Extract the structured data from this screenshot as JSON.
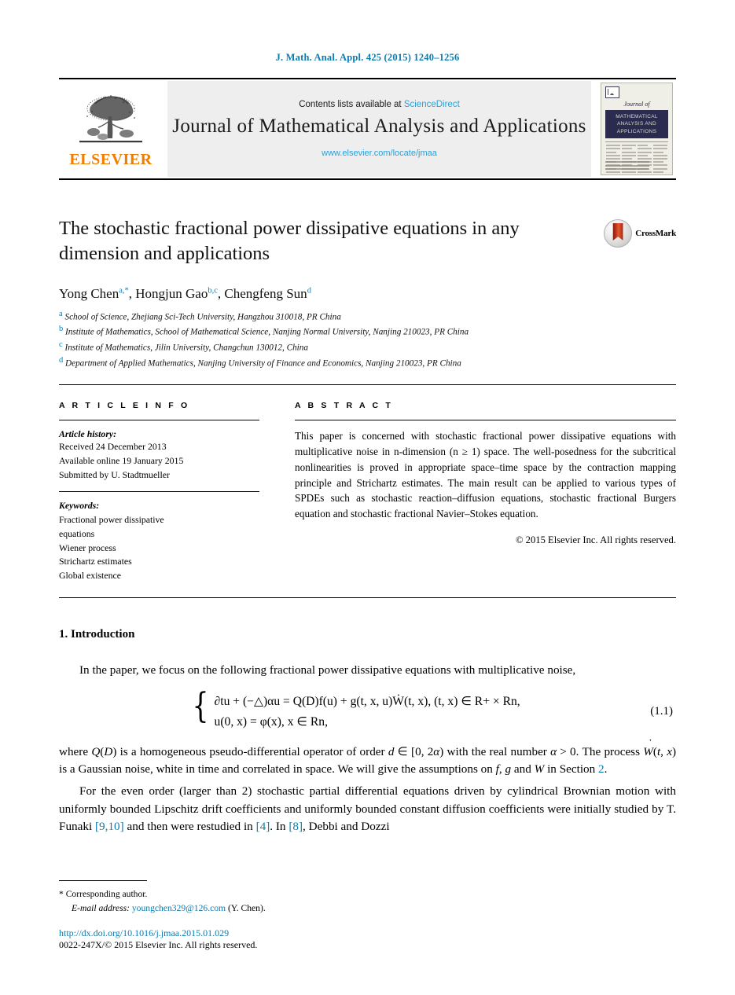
{
  "running_head": "J. Math. Anal. Appl. 425 (2015) 1240–1256",
  "masthead": {
    "publisher_name": "ELSEVIER",
    "contents_prefix": "Contents lists available at ",
    "contents_link": "ScienceDirect",
    "journal_title": "Journal of Mathematical Analysis and Applications",
    "journal_url": "www.elsevier.com/locate/jmaa",
    "cover": {
      "script_title": "Journal of",
      "band_title": "MATHEMATICAL ANALYSIS AND APPLICATIONS"
    }
  },
  "article": {
    "title": "The stochastic fractional power dissipative equations in any dimension and applications",
    "crossmark_label": "CrossMark",
    "authors_html": "Yong Chen <sup>a,*</sup>, Hongjun Gao <sup>b,c</sup>, Chengfeng Sun <sup>d</sup>",
    "affiliations": [
      {
        "marker": "a",
        "text": "School of Science, Zhejiang Sci-Tech University, Hangzhou 310018, PR China"
      },
      {
        "marker": "b",
        "text": "Institute of Mathematics, School of Mathematical Science, Nanjing Normal University, Nanjing 210023, PR China"
      },
      {
        "marker": "c",
        "text": "Institute of Mathematics, Jilin University, Changchun 130012, China"
      },
      {
        "marker": "d",
        "text": "Department of Applied Mathematics, Nanjing University of Finance and Economics, Nanjing 210023, PR China"
      }
    ]
  },
  "info": {
    "heading": "A R T I C L E   I N F O",
    "history_label": "Article history:",
    "history": [
      "Received 24 December 2013",
      "Available online 19 January 2015",
      "Submitted by U. Stadtmueller"
    ],
    "keywords_label": "Keywords:",
    "keywords": [
      "Fractional power dissipative",
      "equations",
      "Wiener process",
      "Strichartz estimates",
      "Global existence"
    ]
  },
  "abstract": {
    "heading": "A B S T R A C T",
    "text": "This paper is concerned with stochastic fractional power dissipative equations with multiplicative noise in n-dimension (n ≥ 1) space. The well-posedness for the subcritical nonlinearities is proved in appropriate space–time space by the contraction mapping principle and Strichartz estimates. The main result can be applied to various types of SPDEs such as stochastic reaction–diffusion equations, stochastic fractional Burgers equation and stochastic fractional Navier–Stokes equation.",
    "copyright": "© 2015 Elsevier Inc. All rights reserved."
  },
  "body": {
    "section_title": "1. Introduction",
    "para1": "In the paper, we focus on the following fractional power dissipative equations with multiplicative noise,",
    "equation": {
      "line1": "∂tu + (−△)αu = Q(D)f(u) + g(t, x, u)Ẇ(t, x),   (t, x) ∈ R+ × Rn,",
      "line2": "u(0, x) = φ(x),   x ∈ Rn,",
      "number": "(1.1)"
    },
    "para2_a": "where ",
    "para2_b": " is a homogeneous pseudo-differential operator of order ",
    "para2_c": " with the real number ",
    "para2_d": ". The process ",
    "para2_e": " is a Gaussian noise, white in time and correlated in space. We will give the assumptions on ",
    "para2_f": " in Section ",
    "para2_ref": "2",
    "para3_a": "For the even order (larger than 2) stochastic partial differential equations driven by cylindrical Brownian motion with uniformly bounded Lipschitz drift coefficients and uniformly bounded constant diffusion coefficients were initially studied by T. Funaki ",
    "para3_ref1": "[9,10]",
    "para3_b": " and then were restudied in ",
    "para3_ref2": "[4]",
    "para3_c": ". In ",
    "para3_ref3": "[8]",
    "para3_d": ", Debbi and Dozzi"
  },
  "footer": {
    "corresponding_marker": "*",
    "corresponding_text": "Corresponding author.",
    "email_label": "E-mail address:",
    "email": "youngchen329@126.com",
    "email_suffix": "(Y. Chen).",
    "doi": "http://dx.doi.org/10.1016/j.jmaa.2015.01.029",
    "issn": "0022-247X/© 2015 Elsevier Inc. All rights reserved."
  },
  "colors": {
    "link": "#0b7cb0",
    "sciencedirect": "#2a9fd6",
    "elsevier_orange": "#F07D00",
    "cover_band": "#2b2b4f"
  }
}
